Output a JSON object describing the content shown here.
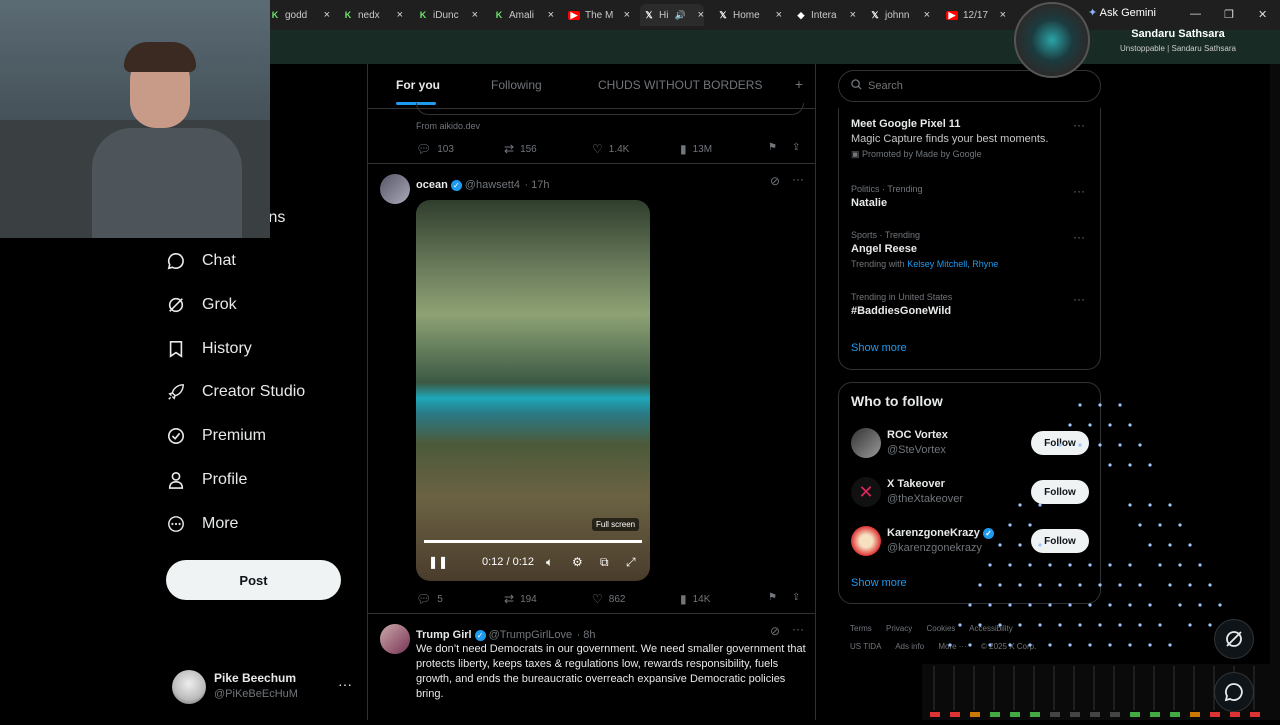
{
  "browser": {
    "tabs": [
      {
        "label": "godd",
        "icon": "k-icon"
      },
      {
        "label": "nedx",
        "icon": "k-icon"
      },
      {
        "label": "iDunc",
        "icon": "k-icon"
      },
      {
        "label": "Amali",
        "icon": "k-icon"
      },
      {
        "label": "The M",
        "icon": "youtube-icon"
      },
      {
        "label": "Hi",
        "icon": "x-icon"
      },
      {
        "label": "Home",
        "icon": "x-icon"
      },
      {
        "label": "Intera",
        "icon": "diamond-icon"
      },
      {
        "label": "johnn",
        "icon": "x-icon"
      },
      {
        "label": "12/17",
        "icon": "youtube-icon"
      }
    ],
    "ask_gemini": "Ask Gemini",
    "close_symbol": "×"
  },
  "stream_overlay": {
    "name": "Sandaru Sathsara",
    "subtitle": "Unstoppable | Sandaru Sathsara"
  },
  "nav": {
    "partial_item": "ions",
    "items": [
      {
        "label": "Chat",
        "icon": "chat-icon"
      },
      {
        "label": "Grok",
        "icon": "grok-icon"
      },
      {
        "label": "History",
        "icon": "bookmark-icon"
      },
      {
        "label": "Creator Studio",
        "icon": "rocket-icon"
      },
      {
        "label": "Premium",
        "icon": "verified-badge-icon"
      },
      {
        "label": "Profile",
        "icon": "person-icon"
      },
      {
        "label": "More",
        "icon": "more-circle-icon"
      }
    ],
    "post_label": "Post"
  },
  "account": {
    "name": "Pike Beechum",
    "handle": "@PiKeBeEcHuM",
    "more": "···"
  },
  "feed": {
    "tabs": [
      {
        "label": "For you",
        "active": true
      },
      {
        "label": "Following",
        "active": false
      },
      {
        "label": "CHUDS WITHOUT BORDERS",
        "active": false
      }
    ],
    "add_tab": "+",
    "top_tweet": {
      "source": "From aikido.dev",
      "replies": "103",
      "reposts": "156",
      "likes": "1.4K",
      "views": "13M"
    },
    "video_tweet": {
      "name": "ocean",
      "handle": "@hawsett4",
      "time": "· 17h",
      "video_time": "0:12 / 0:12",
      "tooltip": "Full screen",
      "progress": 1.0,
      "replies": "5",
      "reposts": "194",
      "likes": "862",
      "views": "14K"
    },
    "text_tweet": {
      "name": "Trump Girl",
      "handle": "@TrumpGirlLove",
      "time": "· 8h",
      "text": "We don’t need Democrats in our government. We need smaller government that protects liberty, keeps taxes & regulations low, rewards responsibility, fuels growth, and ends the bureaucratic overreach expansive Democratic policies bring."
    }
  },
  "sidebar": {
    "search_placeholder": "Search",
    "promo": {
      "title": "Meet Google Pixel 11",
      "body": "Magic Capture finds your best moments.",
      "promoted": "Promoted by Made by Google"
    },
    "trends": [
      {
        "meta": "Politics · Trending",
        "title": "Natalie"
      },
      {
        "meta": "Sports · Trending",
        "title": "Angel Reese",
        "with_label": "Trending with",
        "with_links": "Kelsey Mitchell, Rhyne"
      },
      {
        "meta": "Trending in United States",
        "title": "#BaddiesGoneWild"
      }
    ],
    "show_more": "Show more",
    "who_to_follow": {
      "title": "Who to follow",
      "users": [
        {
          "name": "ROC Vortex",
          "handle": "@SteVortex",
          "verified": false,
          "button": "Follow"
        },
        {
          "name": "X Takeover",
          "handle": "@theXtakeover",
          "verified": false,
          "button": "Follow"
        },
        {
          "name": "KarenzgoneKrazy",
          "handle": "@karenzgonekrazy",
          "verified": true,
          "button": "Follow"
        }
      ],
      "show_more": "Show more"
    },
    "footer": [
      "Terms",
      "Privacy",
      "Cookies",
      "Accessibility",
      "US TIDA",
      "Ads info",
      "More ···",
      "© 2025 X Corp."
    ]
  },
  "colors": {
    "accent": "#1d9bf0",
    "background": "#000000",
    "border": "#2f3336",
    "muted": "#71767b"
  }
}
